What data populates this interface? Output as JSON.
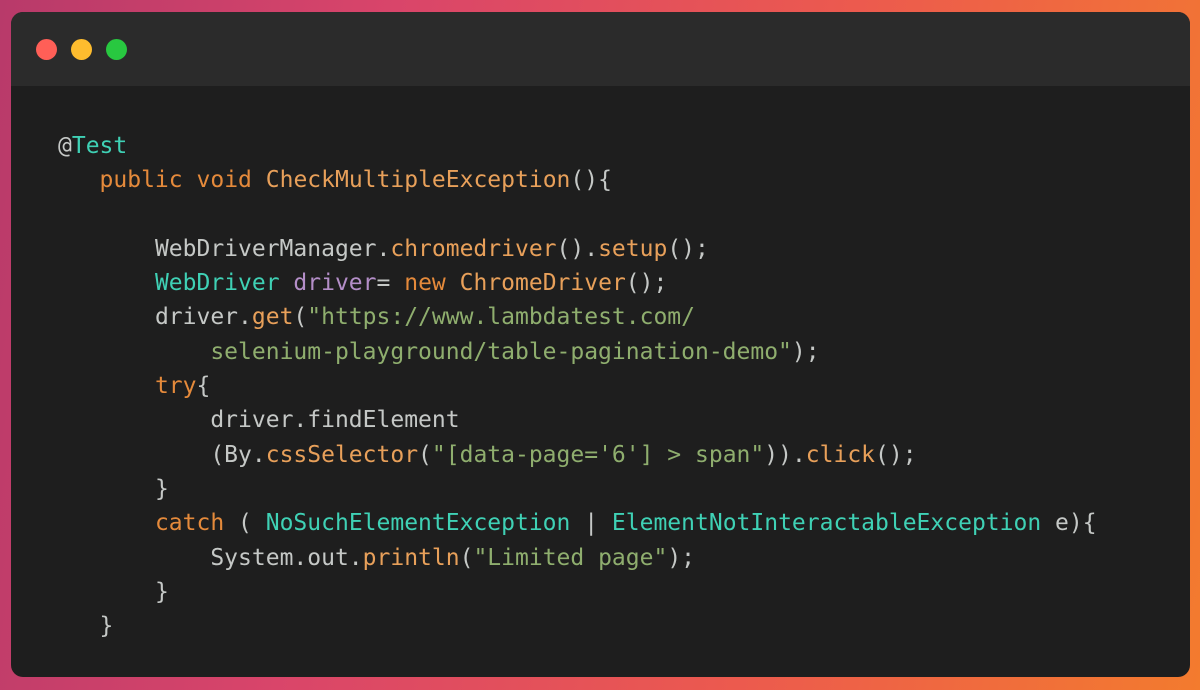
{
  "window": {
    "controls": [
      {
        "name": "close",
        "color": "#ff5f57"
      },
      {
        "name": "minimize",
        "color": "#febc2e"
      },
      {
        "name": "maximize",
        "color": "#28c840"
      }
    ]
  },
  "code": {
    "lines": [
      [
        {
          "t": "@",
          "c": "annotation"
        },
        {
          "t": "Test",
          "c": "anno-name"
        }
      ],
      [
        {
          "t": "   ",
          "c": "plain"
        },
        {
          "t": "public",
          "c": "keyword"
        },
        {
          "t": " ",
          "c": "plain"
        },
        {
          "t": "void",
          "c": "keyword"
        },
        {
          "t": " ",
          "c": "plain"
        },
        {
          "t": "CheckMultipleException",
          "c": "class"
        },
        {
          "t": "(){",
          "c": "punct"
        }
      ],
      [],
      [
        {
          "t": "       ",
          "c": "plain"
        },
        {
          "t": "WebDriverManager.",
          "c": "plain"
        },
        {
          "t": "chromedriver",
          "c": "method"
        },
        {
          "t": "().",
          "c": "punct"
        },
        {
          "t": "setup",
          "c": "method"
        },
        {
          "t": "();",
          "c": "punct"
        }
      ],
      [
        {
          "t": "       ",
          "c": "plain"
        },
        {
          "t": "WebDriver",
          "c": "type"
        },
        {
          "t": " ",
          "c": "plain"
        },
        {
          "t": "driver",
          "c": "var"
        },
        {
          "t": "= ",
          "c": "punct"
        },
        {
          "t": "new",
          "c": "keyword"
        },
        {
          "t": " ",
          "c": "plain"
        },
        {
          "t": "ChromeDriver",
          "c": "class"
        },
        {
          "t": "();",
          "c": "punct"
        }
      ],
      [
        {
          "t": "       ",
          "c": "plain"
        },
        {
          "t": "driver.",
          "c": "plain"
        },
        {
          "t": "get",
          "c": "method"
        },
        {
          "t": "(",
          "c": "punct"
        },
        {
          "t": "\"https://www.lambdatest.com/",
          "c": "string"
        }
      ],
      [
        {
          "t": "           ",
          "c": "plain"
        },
        {
          "t": "selenium-playground/table-pagination-demo\"",
          "c": "string"
        },
        {
          "t": ");",
          "c": "punct"
        }
      ],
      [
        {
          "t": "       ",
          "c": "plain"
        },
        {
          "t": "try",
          "c": "keyword"
        },
        {
          "t": "{",
          "c": "punct"
        }
      ],
      [
        {
          "t": "           ",
          "c": "plain"
        },
        {
          "t": "driver.findElement",
          "c": "plain"
        }
      ],
      [
        {
          "t": "           ",
          "c": "plain"
        },
        {
          "t": "(By.",
          "c": "plain"
        },
        {
          "t": "cssSelector",
          "c": "method"
        },
        {
          "t": "(",
          "c": "punct"
        },
        {
          "t": "\"[data-page='6'] > span\"",
          "c": "string"
        },
        {
          "t": ")).",
          "c": "punct"
        },
        {
          "t": "click",
          "c": "method"
        },
        {
          "t": "();",
          "c": "punct"
        }
      ],
      [
        {
          "t": "       ",
          "c": "plain"
        },
        {
          "t": "}",
          "c": "punct"
        }
      ],
      [
        {
          "t": "       ",
          "c": "plain"
        },
        {
          "t": "catch",
          "c": "keyword"
        },
        {
          "t": " ( ",
          "c": "punct"
        },
        {
          "t": "NoSuchElementException",
          "c": "type"
        },
        {
          "t": " | ",
          "c": "punct"
        },
        {
          "t": "ElementNotInteractableException",
          "c": "type"
        },
        {
          "t": " e){",
          "c": "punct"
        }
      ],
      [
        {
          "t": "           ",
          "c": "plain"
        },
        {
          "t": "System.out.",
          "c": "plain"
        },
        {
          "t": "println",
          "c": "method"
        },
        {
          "t": "(",
          "c": "punct"
        },
        {
          "t": "\"Limited page\"",
          "c": "string"
        },
        {
          "t": ");",
          "c": "punct"
        }
      ],
      [
        {
          "t": "       ",
          "c": "plain"
        },
        {
          "t": "}",
          "c": "punct"
        }
      ],
      [
        {
          "t": "   ",
          "c": "plain"
        },
        {
          "t": "}",
          "c": "punct"
        }
      ]
    ]
  }
}
